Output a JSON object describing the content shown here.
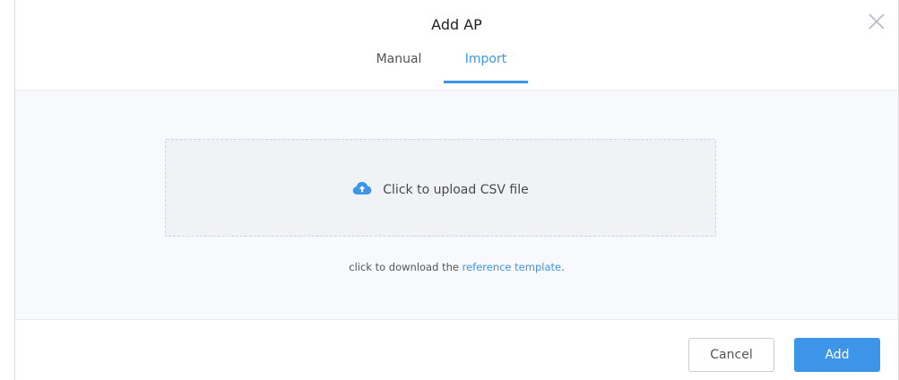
{
  "dialog": {
    "title": "Add AP",
    "close_icon": "close-icon"
  },
  "tabs": [
    {
      "label": "Manual",
      "active": false
    },
    {
      "label": "Import",
      "active": true
    }
  ],
  "upload": {
    "icon": "cloud-upload-icon",
    "label": "Click to upload CSV file"
  },
  "hint": {
    "prefix": "click to download the ",
    "link": "reference template",
    "suffix": "."
  },
  "footer": {
    "cancel_label": "Cancel",
    "add_label": "Add"
  },
  "colors": {
    "accent": "#3d95ea",
    "body_bg": "#f7f9fc"
  }
}
